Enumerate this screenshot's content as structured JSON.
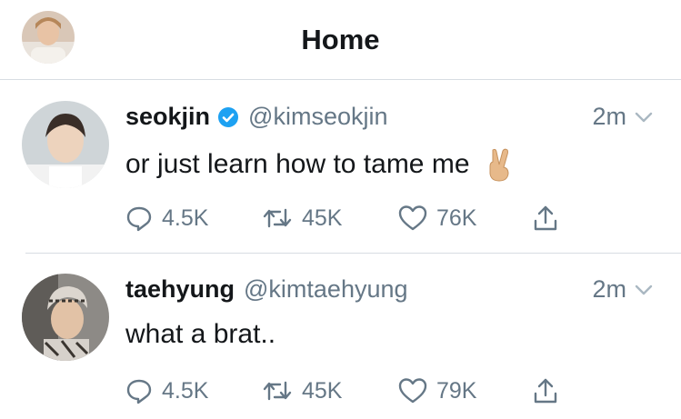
{
  "header": {
    "title": "Home"
  },
  "tweets": [
    {
      "name": "seokjin",
      "verified": true,
      "handle": "@kimseokjin",
      "time": "2m",
      "text": "or just learn how to tame me",
      "emoji": "victory-hand",
      "replies": "4.5K",
      "retweets": "45K",
      "likes": "76K"
    },
    {
      "name": "taehyung",
      "verified": false,
      "handle": "@kimtaehyung",
      "time": "2m",
      "text": "what a brat..",
      "replies": "4.5K",
      "retweets": "45K",
      "likes": "79K"
    }
  ],
  "colors": {
    "text": "#14171a",
    "secondary": "#657786",
    "verified": "#1da1f2",
    "divider": "#d8dde2"
  }
}
